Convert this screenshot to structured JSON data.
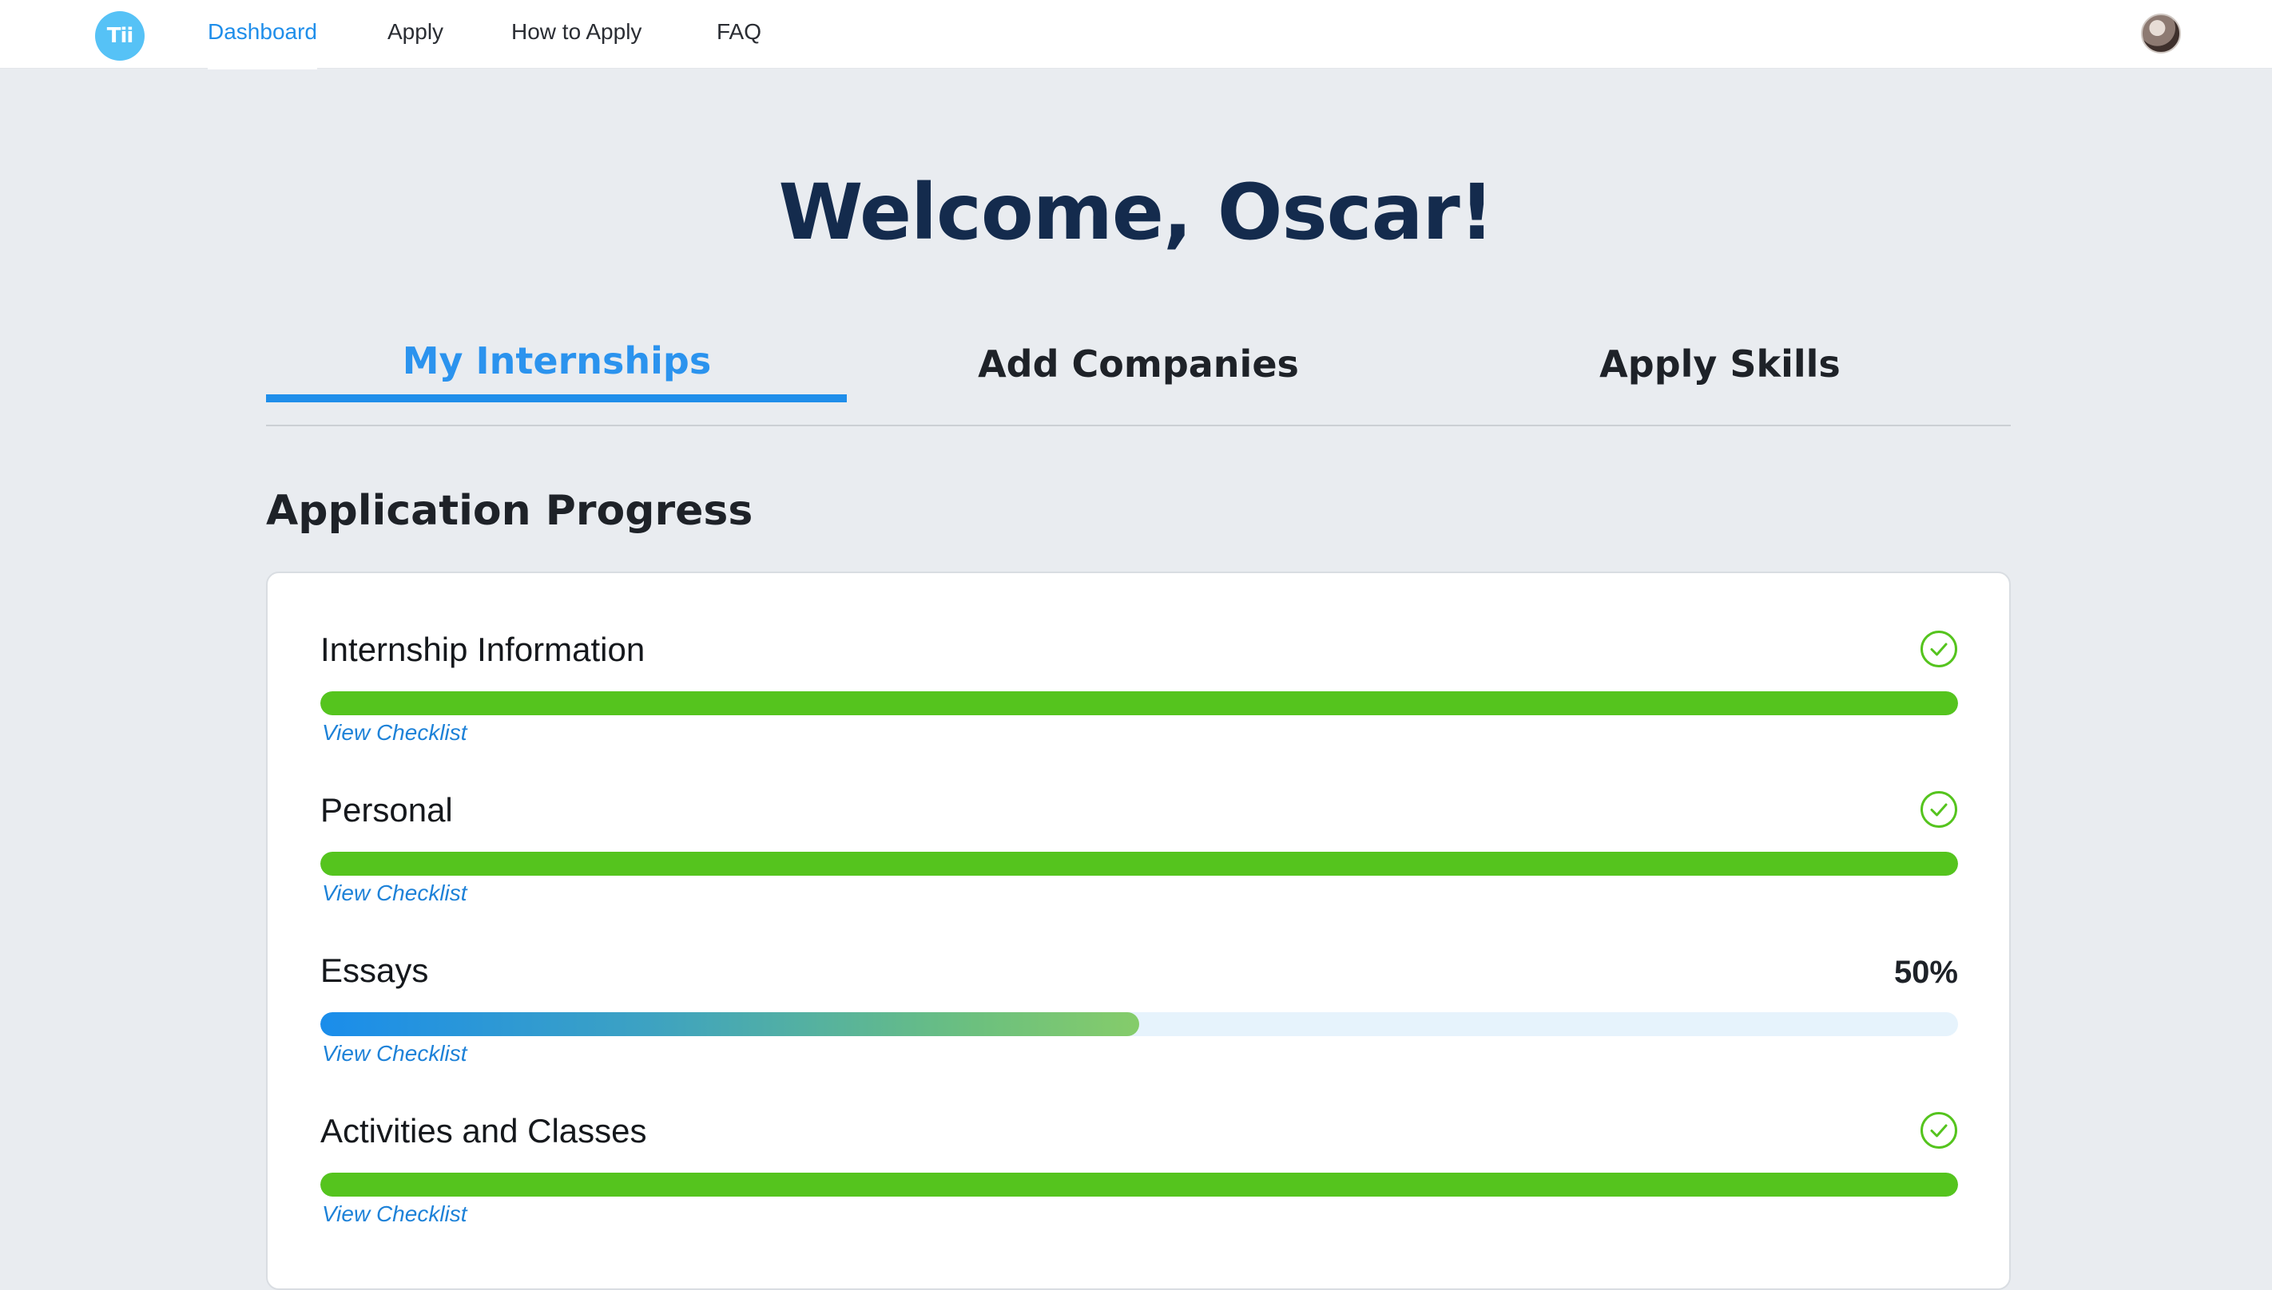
{
  "nav": {
    "logo_text": "Tii",
    "items": [
      {
        "label": "Dashboard",
        "active": true
      },
      {
        "label": "Apply",
        "active": false
      },
      {
        "label": "How to Apply",
        "active": false
      },
      {
        "label": "FAQ",
        "active": false
      }
    ]
  },
  "header": {
    "welcome": "Welcome, Oscar!"
  },
  "tabs": [
    {
      "label": "My Internships",
      "active": true
    },
    {
      "label": "Add Companies",
      "active": false
    },
    {
      "label": "Apply Skills",
      "active": false
    }
  ],
  "progress": {
    "section_title": "Application Progress",
    "items": [
      {
        "title": "Internship Information",
        "progress": 1.0,
        "complete": true,
        "status_icon": "check-circle-icon",
        "link": "View Checklist"
      },
      {
        "title": "Personal",
        "progress": 1.0,
        "complete": true,
        "status_icon": "check-circle-icon",
        "link": "View Checklist"
      },
      {
        "title": "Essays",
        "progress": 0.5,
        "complete": false,
        "percent_label": "50%",
        "link": "View Checklist"
      },
      {
        "title": "Activities and Classes",
        "progress": 1.0,
        "complete": true,
        "status_icon": "check-circle-icon",
        "link": "View Checklist"
      }
    ]
  },
  "colors": {
    "accent": "#1F8EEA",
    "complete": "#55C41E",
    "title": "#142B4D"
  }
}
